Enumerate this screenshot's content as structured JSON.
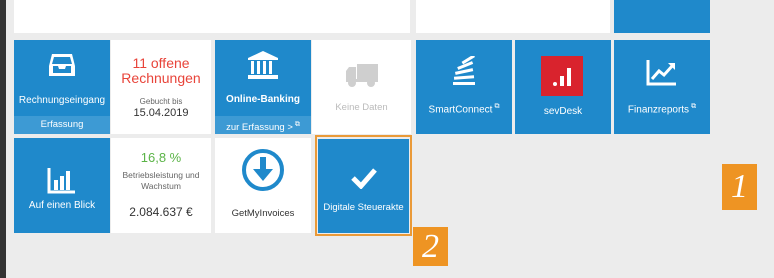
{
  "tiles": {
    "rechnungseingang": {
      "label": "Rechnungseingang",
      "action": "Erfassung"
    },
    "offene": {
      "headline": "11 offene Rechnungen",
      "line1": "Gebucht bis",
      "line2": "15.04.2019"
    },
    "onlinebanking": {
      "label": "Online-Banking",
      "action": "zur Erfassung >"
    },
    "keinedaten": {
      "label": "Keine Daten"
    },
    "smartconnect": {
      "label": "SmartConnect"
    },
    "sevdesk": {
      "label": "sevDesk"
    },
    "finanzreports": {
      "label": "Finanzreports"
    },
    "aufeinenblick": {
      "label": "Auf einen Blick"
    },
    "wachstum": {
      "value": "16,8 %",
      "caption": "Betriebsleistung und Wachstum",
      "amount": "2.084.637 €"
    },
    "getmyinvoices": {
      "label": "GetMyInvoices"
    },
    "steuerakte": {
      "label": "Digitale Steuerakte"
    }
  },
  "badges": {
    "one": "1",
    "two": "2"
  },
  "colors": {
    "tile_blue": "#1f89cb",
    "action_bar": "#3d9ad4",
    "red_text": "#e8443a",
    "green_text": "#5bb447",
    "highlight_orange": "#ee9423",
    "sevdesk_red": "#d9232d"
  }
}
